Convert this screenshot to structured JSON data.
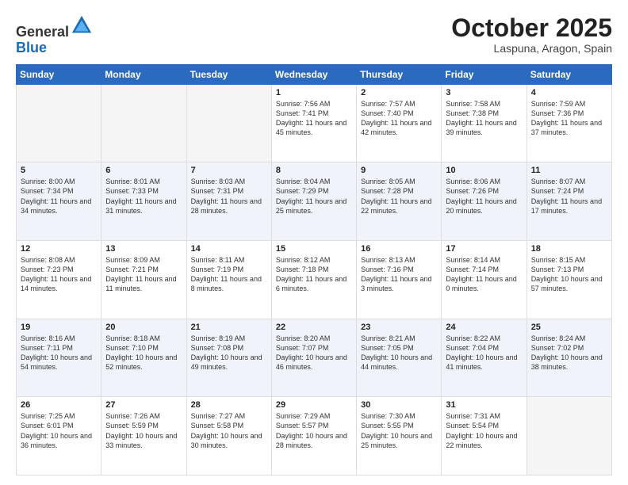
{
  "header": {
    "logo_general": "General",
    "logo_blue": "Blue",
    "month": "October 2025",
    "location": "Laspuna, Aragon, Spain"
  },
  "weekdays": [
    "Sunday",
    "Monday",
    "Tuesday",
    "Wednesday",
    "Thursday",
    "Friday",
    "Saturday"
  ],
  "weeks": [
    [
      {
        "day": "",
        "empty": true
      },
      {
        "day": "",
        "empty": true
      },
      {
        "day": "",
        "empty": true
      },
      {
        "day": "1",
        "sunrise": "7:56 AM",
        "sunset": "7:41 PM",
        "daylight": "11 hours and 45 minutes."
      },
      {
        "day": "2",
        "sunrise": "7:57 AM",
        "sunset": "7:40 PM",
        "daylight": "11 hours and 42 minutes."
      },
      {
        "day": "3",
        "sunrise": "7:58 AM",
        "sunset": "7:38 PM",
        "daylight": "11 hours and 39 minutes."
      },
      {
        "day": "4",
        "sunrise": "7:59 AM",
        "sunset": "7:36 PM",
        "daylight": "11 hours and 37 minutes."
      }
    ],
    [
      {
        "day": "5",
        "sunrise": "8:00 AM",
        "sunset": "7:34 PM",
        "daylight": "11 hours and 34 minutes."
      },
      {
        "day": "6",
        "sunrise": "8:01 AM",
        "sunset": "7:33 PM",
        "daylight": "11 hours and 31 minutes."
      },
      {
        "day": "7",
        "sunrise": "8:03 AM",
        "sunset": "7:31 PM",
        "daylight": "11 hours and 28 minutes."
      },
      {
        "day": "8",
        "sunrise": "8:04 AM",
        "sunset": "7:29 PM",
        "daylight": "11 hours and 25 minutes."
      },
      {
        "day": "9",
        "sunrise": "8:05 AM",
        "sunset": "7:28 PM",
        "daylight": "11 hours and 22 minutes."
      },
      {
        "day": "10",
        "sunrise": "8:06 AM",
        "sunset": "7:26 PM",
        "daylight": "11 hours and 20 minutes."
      },
      {
        "day": "11",
        "sunrise": "8:07 AM",
        "sunset": "7:24 PM",
        "daylight": "11 hours and 17 minutes."
      }
    ],
    [
      {
        "day": "12",
        "sunrise": "8:08 AM",
        "sunset": "7:23 PM",
        "daylight": "11 hours and 14 minutes."
      },
      {
        "day": "13",
        "sunrise": "8:09 AM",
        "sunset": "7:21 PM",
        "daylight": "11 hours and 11 minutes."
      },
      {
        "day": "14",
        "sunrise": "8:11 AM",
        "sunset": "7:19 PM",
        "daylight": "11 hours and 8 minutes."
      },
      {
        "day": "15",
        "sunrise": "8:12 AM",
        "sunset": "7:18 PM",
        "daylight": "11 hours and 6 minutes."
      },
      {
        "day": "16",
        "sunrise": "8:13 AM",
        "sunset": "7:16 PM",
        "daylight": "11 hours and 3 minutes."
      },
      {
        "day": "17",
        "sunrise": "8:14 AM",
        "sunset": "7:14 PM",
        "daylight": "11 hours and 0 minutes."
      },
      {
        "day": "18",
        "sunrise": "8:15 AM",
        "sunset": "7:13 PM",
        "daylight": "10 hours and 57 minutes."
      }
    ],
    [
      {
        "day": "19",
        "sunrise": "8:16 AM",
        "sunset": "7:11 PM",
        "daylight": "10 hours and 54 minutes."
      },
      {
        "day": "20",
        "sunrise": "8:18 AM",
        "sunset": "7:10 PM",
        "daylight": "10 hours and 52 minutes."
      },
      {
        "day": "21",
        "sunrise": "8:19 AM",
        "sunset": "7:08 PM",
        "daylight": "10 hours and 49 minutes."
      },
      {
        "day": "22",
        "sunrise": "8:20 AM",
        "sunset": "7:07 PM",
        "daylight": "10 hours and 46 minutes."
      },
      {
        "day": "23",
        "sunrise": "8:21 AM",
        "sunset": "7:05 PM",
        "daylight": "10 hours and 44 minutes."
      },
      {
        "day": "24",
        "sunrise": "8:22 AM",
        "sunset": "7:04 PM",
        "daylight": "10 hours and 41 minutes."
      },
      {
        "day": "25",
        "sunrise": "8:24 AM",
        "sunset": "7:02 PM",
        "daylight": "10 hours and 38 minutes."
      }
    ],
    [
      {
        "day": "26",
        "sunrise": "7:25 AM",
        "sunset": "6:01 PM",
        "daylight": "10 hours and 36 minutes."
      },
      {
        "day": "27",
        "sunrise": "7:26 AM",
        "sunset": "5:59 PM",
        "daylight": "10 hours and 33 minutes."
      },
      {
        "day": "28",
        "sunrise": "7:27 AM",
        "sunset": "5:58 PM",
        "daylight": "10 hours and 30 minutes."
      },
      {
        "day": "29",
        "sunrise": "7:29 AM",
        "sunset": "5:57 PM",
        "daylight": "10 hours and 28 minutes."
      },
      {
        "day": "30",
        "sunrise": "7:30 AM",
        "sunset": "5:55 PM",
        "daylight": "10 hours and 25 minutes."
      },
      {
        "day": "31",
        "sunrise": "7:31 AM",
        "sunset": "5:54 PM",
        "daylight": "10 hours and 22 minutes."
      },
      {
        "day": "",
        "empty": true
      }
    ]
  ]
}
